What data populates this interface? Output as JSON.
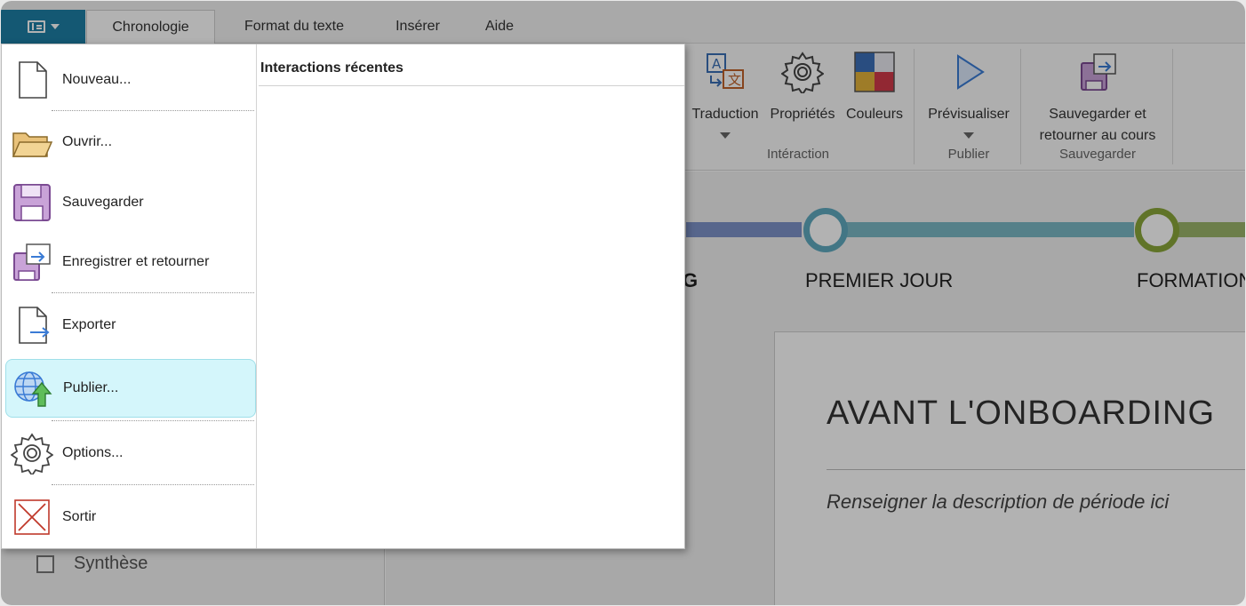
{
  "tabs": [
    {
      "label": "Chronologie",
      "active": true
    },
    {
      "label": "Format du texte",
      "active": false
    },
    {
      "label": "Insérer",
      "active": false
    },
    {
      "label": "Aide",
      "active": false
    }
  ],
  "ribbon": {
    "buttons": {
      "traduction": "Traduction",
      "proprietes": "Propriétés",
      "couleurs": "Couleurs",
      "previsualiser": "Prévisualiser",
      "sauvegarder_retourner_1": "Sauvegarder et",
      "sauvegarder_retourner_2": "retourner au cours"
    },
    "groups": {
      "interaction": "Intéraction",
      "publier": "Publier",
      "sauvegarder": "Sauvegarder"
    }
  },
  "left_pane": {
    "visible_item": "Synthèse"
  },
  "timeline": {
    "labels": [
      "G",
      "PREMIER JOUR",
      "FORMATION"
    ],
    "colors": {
      "segment1": "#7d93c9",
      "segment2": "#7ab8c4",
      "segment3": "#9bb56a",
      "node2": "#5fa9bf",
      "node3": "#8aa63a"
    }
  },
  "card": {
    "title": "AVANT L'ONBOARDING",
    "description": "Renseigner la description de période ici"
  },
  "file_menu": {
    "items": [
      {
        "label": "Nouveau...",
        "icon": "new-file-icon"
      },
      {
        "label": "Ouvrir...",
        "icon": "folder-icon"
      },
      {
        "label": "Sauvegarder",
        "icon": "floppy-disk-icon"
      },
      {
        "label": "Enregistrer et retourner",
        "icon": "save-return-icon"
      },
      {
        "label": "Exporter",
        "icon": "export-icon"
      },
      {
        "label": "Publier...",
        "icon": "globe-upload-icon"
      },
      {
        "label": "Options...",
        "icon": "gear-icon"
      },
      {
        "label": "Sortir",
        "icon": "exit-x-icon"
      }
    ],
    "recent_title": "Interactions récentes"
  },
  "colors": {
    "accent": "#1e7fa5",
    "highlight_bg": "#d4f6fb"
  }
}
